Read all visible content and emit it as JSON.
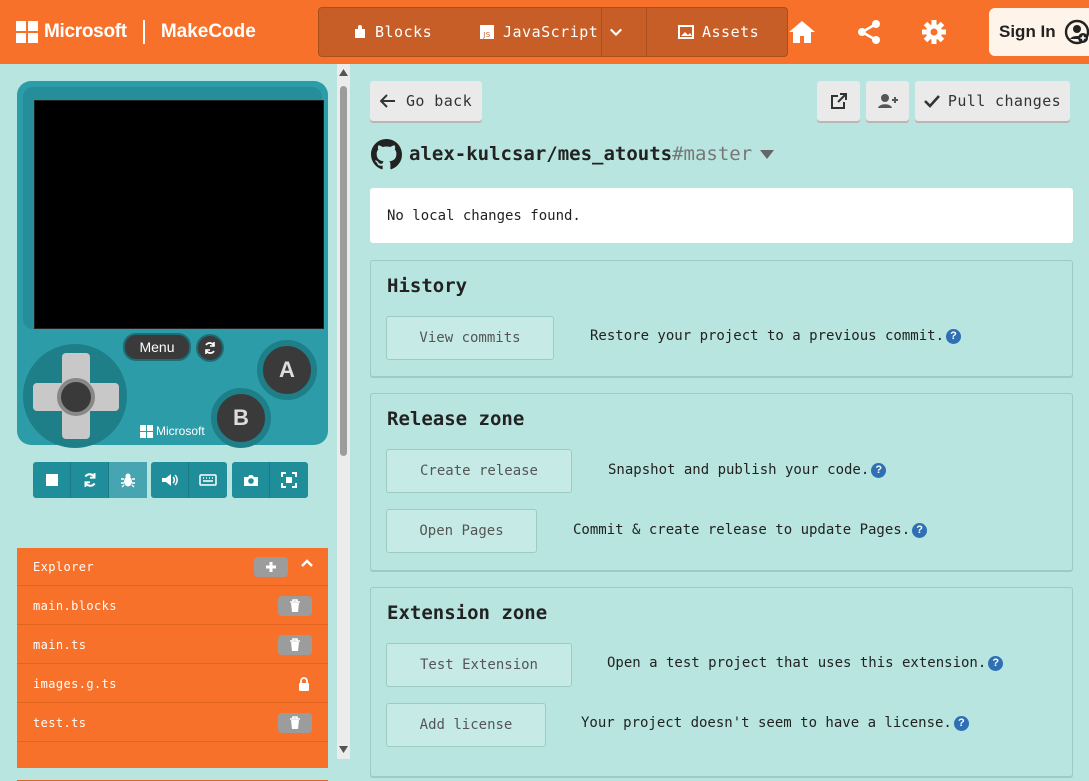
{
  "header": {
    "brand": "Microsoft",
    "product": "MakeCode",
    "modes": {
      "blocks": "Blocks",
      "javascript": "JavaScript",
      "assets": "Assets"
    },
    "sign_in": "Sign In",
    "accent": "#f7712a"
  },
  "simulator": {
    "menu_label": "Menu",
    "a_label": "A",
    "b_label": "B",
    "device_brand": "Microsoft"
  },
  "explorer": {
    "title": "Explorer",
    "files": [
      {
        "name": "main.blocks",
        "action": "trash-icon"
      },
      {
        "name": "main.ts",
        "action": "trash-icon"
      },
      {
        "name": "images.g.ts",
        "action": "lock-icon"
      },
      {
        "name": "test.ts",
        "action": "trash-icon"
      }
    ]
  },
  "github": {
    "go_back": "Go back",
    "pull_changes": "Pull changes",
    "repo": "alex-kulcsar/mes_atouts",
    "branch": "#master",
    "status": "No local changes found.",
    "history": {
      "title": "History",
      "view_commits": "View commits",
      "view_commits_desc": "Restore your project to a previous commit."
    },
    "release": {
      "title": "Release zone",
      "create_release": "Create release",
      "create_release_desc": "Snapshot and publish your code.",
      "open_pages": "Open Pages",
      "open_pages_desc": "Commit & create release to update Pages."
    },
    "extension": {
      "title": "Extension zone",
      "test_extension": "Test Extension",
      "test_extension_desc": "Open a test project that uses this extension.",
      "add_license": "Add license",
      "add_license_desc": "Your project doesn't seem to have a license."
    },
    "help_glyph": "?"
  }
}
